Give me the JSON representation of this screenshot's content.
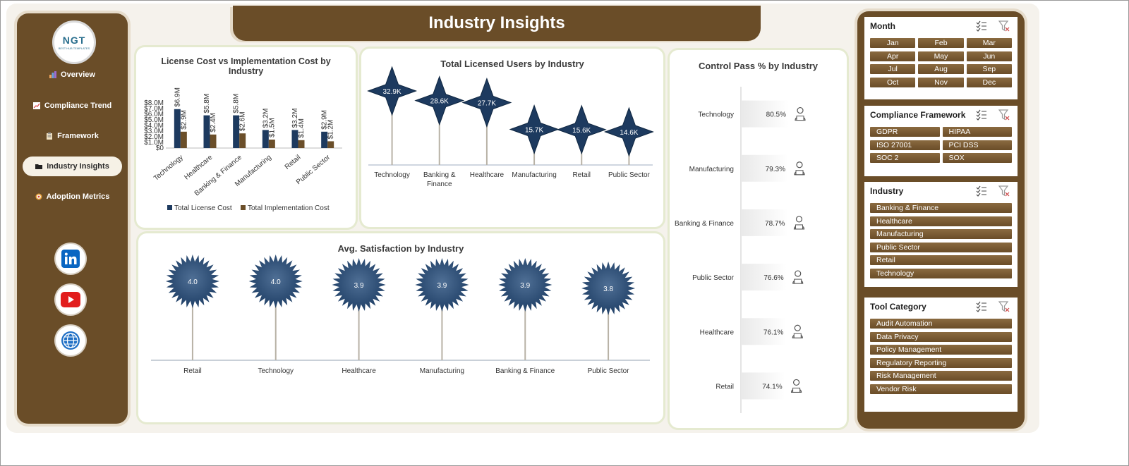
{
  "header": {
    "title": "Industry Insights"
  },
  "sidebar": {
    "logo_text": "NGT",
    "logo_tagline": "BEST HUB TEMPLATES",
    "items": [
      {
        "label": "Overview",
        "icon": "bar-chart-icon",
        "active": false
      },
      {
        "label": "Compliance Trend",
        "icon": "trend-icon",
        "active": false
      },
      {
        "label": "Framework",
        "icon": "clipboard-icon",
        "active": false
      },
      {
        "label": "Industry Insights",
        "icon": "folder-icon",
        "active": true
      },
      {
        "label": "Adoption Metrics",
        "icon": "target-icon",
        "active": false
      }
    ],
    "social": [
      "linkedin-icon",
      "youtube-icon",
      "globe-icon"
    ]
  },
  "colors": {
    "brown": "#6a4d28",
    "navy": "#1d3a5f",
    "cost_brown": "#6b4f2a"
  },
  "filters": [
    {
      "title": "Month",
      "columns": 3,
      "items": [
        "Jan",
        "Feb",
        "Mar",
        "Apr",
        "May",
        "Jun",
        "Jul",
        "Aug",
        "Sep",
        "Oct",
        "Nov",
        "Dec"
      ]
    },
    {
      "title": "Compliance Framework",
      "columns": 2,
      "items": [
        "GDPR",
        "HIPAA",
        "ISO 27001",
        "PCI DSS",
        "SOC 2",
        "SOX"
      ]
    },
    {
      "title": "Industry",
      "columns": 1,
      "items": [
        "Banking & Finance",
        "Healthcare",
        "Manufacturing",
        "Public Sector",
        "Retail",
        "Technology"
      ]
    },
    {
      "title": "Tool Category",
      "columns": 1,
      "items": [
        "Audit Automation",
        "Data Privacy",
        "Policy Management",
        "Regulatory Reporting",
        "Risk Management",
        "Vendor Risk"
      ]
    }
  ],
  "chart_data": [
    {
      "type": "bar",
      "title": "License Cost vs Implementation Cost by Industry",
      "categories": [
        "Technology",
        "Healthcare",
        "Banking & Finance",
        "Manufacturing",
        "Retail",
        "Public Sector"
      ],
      "series": [
        {
          "name": "Total License Cost",
          "values": [
            6.9,
            5.8,
            5.8,
            3.2,
            3.2,
            2.9
          ],
          "labels": [
            "$6.9M",
            "$5.8M",
            "$5.8M",
            "$3.2M",
            "$3.2M",
            "$2.9M"
          ]
        },
        {
          "name": "Total Implementation Cost",
          "values": [
            2.9,
            2.4,
            2.6,
            1.5,
            1.4,
            1.2
          ],
          "labels": [
            "$2.9M",
            "$2.4M",
            "$2.6M",
            "$1.5M",
            "$1.4M",
            "$1.2M"
          ]
        }
      ],
      "ylim": [
        0,
        8
      ],
      "yticks": [
        "$0",
        "$1.0M",
        "$2.0M",
        "$3.0M",
        "$4.0M",
        "$5.0M",
        "$6.0M",
        "$7.0M",
        "$8.0M"
      ],
      "legend": "bottom"
    },
    {
      "type": "bar",
      "title": "Total Licensed Users by Industry",
      "categories": [
        "Technology",
        "Banking & Finance",
        "Healthcare",
        "Manufacturing",
        "Retail",
        "Public Sector"
      ],
      "values": [
        32.9,
        28.6,
        27.7,
        15.7,
        15.6,
        14.6
      ],
      "labels": [
        "32.9K",
        "28.6K",
        "27.7K",
        "15.7K",
        "15.6K",
        "14.6K"
      ],
      "marker": "star"
    },
    {
      "type": "bar",
      "title": "Avg. Satisfaction by Industry",
      "categories": [
        "Retail",
        "Technology",
        "Healthcare",
        "Manufacturing",
        "Banking & Finance",
        "Public Sector"
      ],
      "values": [
        4.0,
        4.0,
        3.9,
        3.9,
        3.9,
        3.8
      ],
      "labels": [
        "4.0",
        "4.0",
        "3.9",
        "3.9",
        "3.9",
        "3.8"
      ],
      "marker": "sunburst"
    },
    {
      "type": "bar",
      "orientation": "horizontal",
      "title": "Control Pass % by Industry",
      "categories": [
        "Technology",
        "Manufacturing",
        "Banking & Finance",
        "Public Sector",
        "Healthcare",
        "Retail"
      ],
      "values": [
        80.5,
        79.3,
        78.7,
        76.6,
        76.1,
        74.1
      ],
      "labels": [
        "80.5%",
        "79.3%",
        "78.7%",
        "76.6%",
        "76.1%",
        "74.1%"
      ],
      "marker": "person-icon"
    }
  ]
}
